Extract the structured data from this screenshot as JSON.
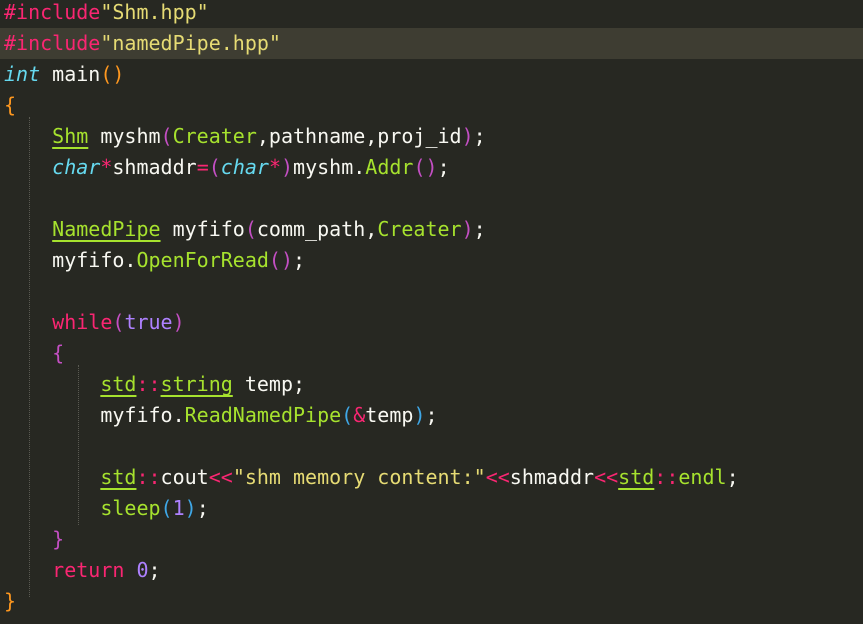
{
  "editor": {
    "language": "C++",
    "theme_colors": {
      "background": "#272822",
      "current_line": "#3e3d32",
      "foreground": "#f8f8f2",
      "preprocessor": "#f92672",
      "string": "#e6db74",
      "type": "#66d9ef",
      "function": "#a6e22e",
      "number": "#ae81ff"
    },
    "current_line_index": 1,
    "lines": [
      [
        {
          "t": "#include",
          "c": "pre"
        },
        {
          "t": "\"Shm.hpp\"",
          "c": "str"
        }
      ],
      [
        {
          "t": "#include",
          "c": "pre"
        },
        {
          "t": "\"namedPipe.hpp\"",
          "c": "str"
        }
      ],
      [
        {
          "t": "int",
          "c": "type"
        },
        {
          "t": " main",
          "c": "plain"
        },
        {
          "t": "()",
          "c": "brace"
        }
      ],
      [
        {
          "t": "{",
          "c": "brace"
        }
      ],
      [
        {
          "t": "    ",
          "c": "plain"
        },
        {
          "t": "Shm",
          "c": "class"
        },
        {
          "t": " myshm",
          "c": "plain"
        },
        {
          "t": "(",
          "c": "paren"
        },
        {
          "t": "Creater",
          "c": "func"
        },
        {
          "t": ",pathname,proj_id",
          "c": "plain"
        },
        {
          "t": ")",
          "c": "paren"
        },
        {
          "t": ";",
          "c": "punct"
        }
      ],
      [
        {
          "t": "    ",
          "c": "plain"
        },
        {
          "t": "char",
          "c": "type"
        },
        {
          "t": "*",
          "c": "op"
        },
        {
          "t": "shmaddr",
          "c": "plain"
        },
        {
          "t": "=",
          "c": "op"
        },
        {
          "t": "(",
          "c": "paren"
        },
        {
          "t": "char",
          "c": "type"
        },
        {
          "t": "*",
          "c": "op"
        },
        {
          "t": ")",
          "c": "paren"
        },
        {
          "t": "myshm.",
          "c": "plain"
        },
        {
          "t": "Addr",
          "c": "func"
        },
        {
          "t": "()",
          "c": "paren"
        },
        {
          "t": ";",
          "c": "punct"
        }
      ],
      [],
      [
        {
          "t": "    ",
          "c": "plain"
        },
        {
          "t": "NamedPipe",
          "c": "class"
        },
        {
          "t": " myfifo",
          "c": "plain"
        },
        {
          "t": "(",
          "c": "paren"
        },
        {
          "t": "comm_path,",
          "c": "plain"
        },
        {
          "t": "Creater",
          "c": "func"
        },
        {
          "t": ")",
          "c": "paren"
        },
        {
          "t": ";",
          "c": "punct"
        }
      ],
      [
        {
          "t": "    myfifo.",
          "c": "plain"
        },
        {
          "t": "OpenForRead",
          "c": "func"
        },
        {
          "t": "()",
          "c": "paren"
        },
        {
          "t": ";",
          "c": "punct"
        }
      ],
      [],
      [
        {
          "t": "    ",
          "c": "plain"
        },
        {
          "t": "while",
          "c": "kw"
        },
        {
          "t": "(",
          "c": "paren"
        },
        {
          "t": "true",
          "c": "const"
        },
        {
          "t": ")",
          "c": "paren"
        }
      ],
      [
        {
          "t": "    ",
          "c": "plain"
        },
        {
          "t": "{",
          "c": "paren"
        }
      ],
      [
        {
          "t": "        ",
          "c": "plain"
        },
        {
          "t": "std",
          "c": "ns"
        },
        {
          "t": "::",
          "c": "op"
        },
        {
          "t": "string",
          "c": "ns"
        },
        {
          "t": " temp;",
          "c": "plain"
        }
      ],
      [
        {
          "t": "        myfifo.",
          "c": "plain"
        },
        {
          "t": "ReadNamedPipe",
          "c": "func"
        },
        {
          "t": "(",
          "c": "paren2"
        },
        {
          "t": "&",
          "c": "op"
        },
        {
          "t": "temp",
          "c": "plain"
        },
        {
          "t": ")",
          "c": "paren2"
        },
        {
          "t": ";",
          "c": "punct"
        }
      ],
      [],
      [
        {
          "t": "        ",
          "c": "plain"
        },
        {
          "t": "std",
          "c": "ns"
        },
        {
          "t": "::",
          "c": "op"
        },
        {
          "t": "cout",
          "c": "plain"
        },
        {
          "t": "<<",
          "c": "op"
        },
        {
          "t": "\"shm memory content:\"",
          "c": "str"
        },
        {
          "t": "<<",
          "c": "op"
        },
        {
          "t": "shmaddr",
          "c": "plain"
        },
        {
          "t": "<<",
          "c": "op"
        },
        {
          "t": "std",
          "c": "ns"
        },
        {
          "t": "::",
          "c": "op"
        },
        {
          "t": "endl",
          "c": "func"
        },
        {
          "t": ";",
          "c": "punct"
        }
      ],
      [
        {
          "t": "        ",
          "c": "plain"
        },
        {
          "t": "sleep",
          "c": "func"
        },
        {
          "t": "(",
          "c": "paren2"
        },
        {
          "t": "1",
          "c": "num"
        },
        {
          "t": ")",
          "c": "paren2"
        },
        {
          "t": ";",
          "c": "punct"
        }
      ],
      [
        {
          "t": "    ",
          "c": "plain"
        },
        {
          "t": "}",
          "c": "paren"
        }
      ],
      [
        {
          "t": "    ",
          "c": "plain"
        },
        {
          "t": "return",
          "c": "kw"
        },
        {
          "t": " ",
          "c": "plain"
        },
        {
          "t": "0",
          "c": "num"
        },
        {
          "t": ";",
          "c": "punct"
        }
      ],
      [
        {
          "t": "}",
          "c": "brace"
        }
      ]
    ]
  }
}
